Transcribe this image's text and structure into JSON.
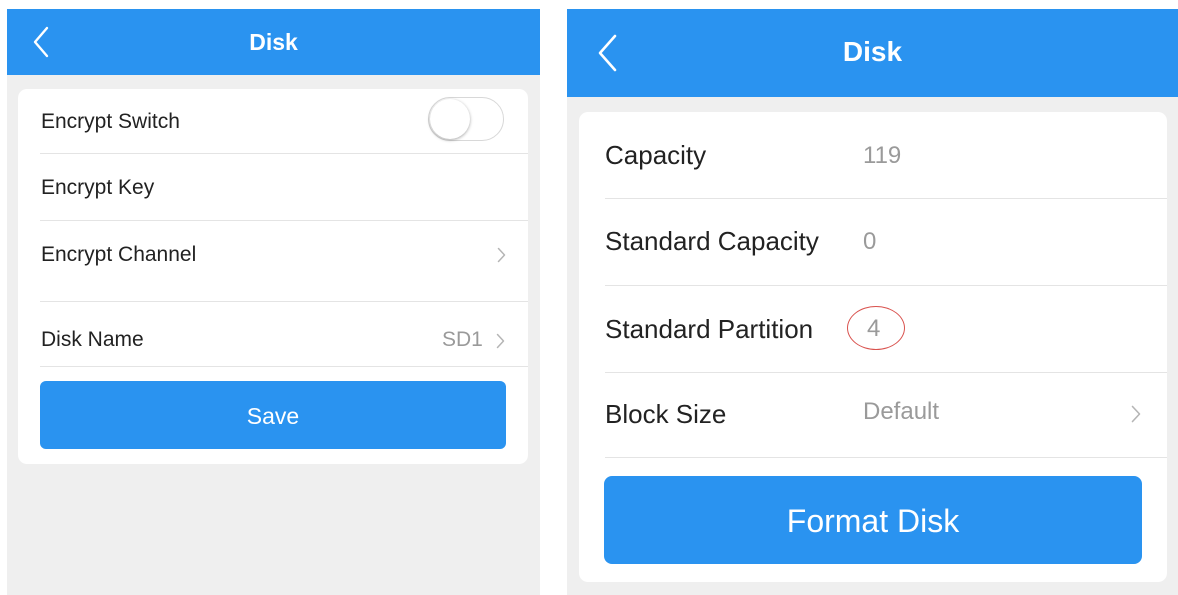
{
  "left_screen": {
    "header": {
      "title": "Disk"
    },
    "rows": {
      "encrypt_switch": {
        "label": "Encrypt Switch",
        "enabled": false
      },
      "encrypt_key": {
        "label": "Encrypt Key"
      },
      "encrypt_channel": {
        "label": "Encrypt Channel"
      },
      "disk_name": {
        "label": "Disk Name",
        "value": "SD1"
      }
    },
    "save_label": "Save"
  },
  "right_screen": {
    "header": {
      "title": "Disk"
    },
    "rows": {
      "capacity": {
        "label": "Capacity",
        "value": "119"
      },
      "standard_capacity": {
        "label": "Standard Capacity",
        "value": "0"
      },
      "standard_partition": {
        "label": "Standard Partition",
        "value": "4"
      },
      "block_size": {
        "label": "Block Size",
        "value": "Default"
      }
    },
    "format_label": "Format Disk"
  },
  "colors": {
    "header_blue": "#2a93f0",
    "background": "#efefef",
    "annotation_red": "#d9534f"
  },
  "icons": [
    "back-chevron-icon",
    "chevron-right-icon"
  ]
}
